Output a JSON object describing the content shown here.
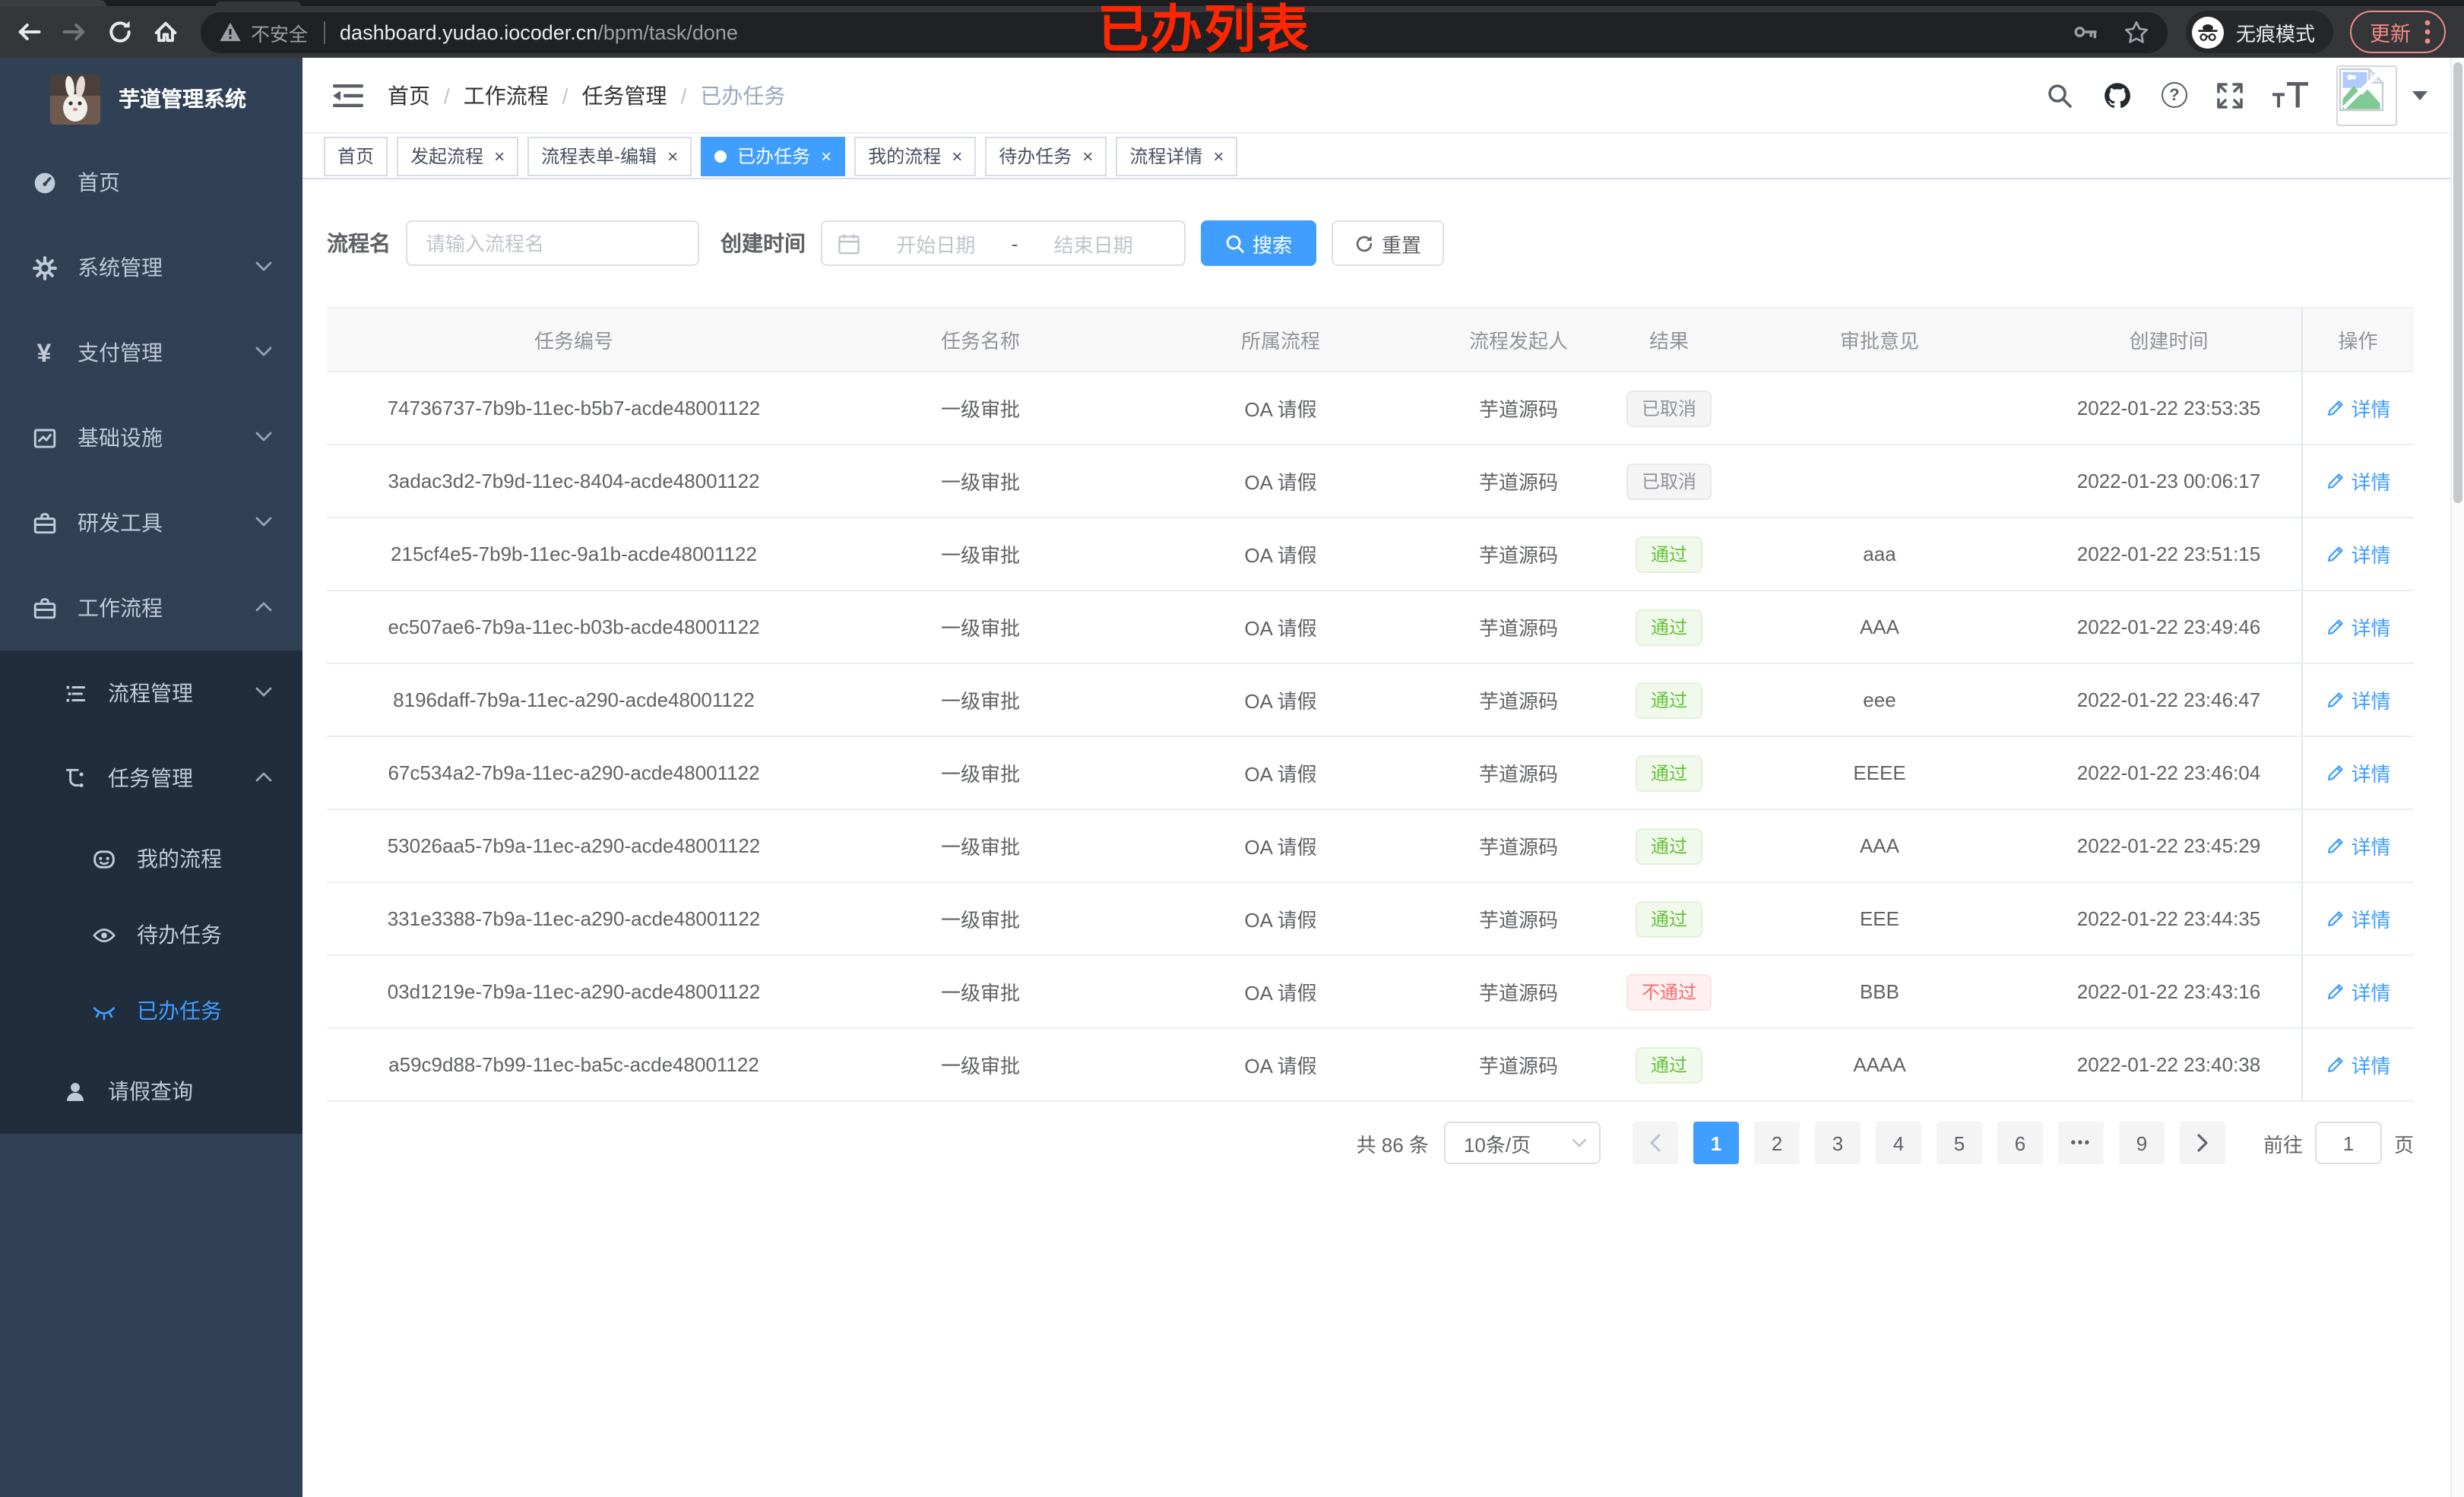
{
  "annotation": {
    "text": "已办列表",
    "color": "#ff2600"
  },
  "browser": {
    "insecure_label": "不安全",
    "url_host": "dashboard.yudao.iocoder.cn",
    "url_path": "/bpm/task/done",
    "incognito_label": "无痕模式",
    "update_label": "更新"
  },
  "sidebar": {
    "title": "芋道管理系统",
    "menu": [
      {
        "label": "首页"
      },
      {
        "label": "系统管理"
      },
      {
        "label": "支付管理"
      },
      {
        "label": "基础设施"
      },
      {
        "label": "研发工具"
      },
      {
        "label": "工作流程"
      },
      {
        "label": "流程管理"
      },
      {
        "label": "任务管理"
      },
      {
        "label": "我的流程"
      },
      {
        "label": "待办任务"
      },
      {
        "label": "已办任务"
      },
      {
        "label": "请假查询"
      }
    ]
  },
  "navbar": {
    "breadcrumb": [
      "首页",
      "工作流程",
      "任务管理",
      "已办任务"
    ],
    "separator": "/",
    "help_glyph": "?"
  },
  "tabs": [
    {
      "label": "首页"
    },
    {
      "label": "发起流程"
    },
    {
      "label": "流程表单-编辑"
    },
    {
      "label": "已办任务"
    },
    {
      "label": "我的流程"
    },
    {
      "label": "待办任务"
    },
    {
      "label": "流程详情"
    }
  ],
  "ui": {
    "close_glyph": "×"
  },
  "filter": {
    "name_label": "流程名",
    "name_placeholder": "请输入流程名",
    "time_label": "创建时间",
    "start_placeholder": "开始日期",
    "range_separator": "-",
    "end_placeholder": "结束日期",
    "search_label": "搜索",
    "reset_label": "重置"
  },
  "table": {
    "columns": [
      "任务编号",
      "任务名称",
      "所属流程",
      "流程发起人",
      "结果",
      "审批意见",
      "创建时间",
      "操作"
    ],
    "rows": [
      {
        "id": "74736737-7b9b-11ec-b5b7-acde48001122",
        "name": "一级审批",
        "process": "OA 请假",
        "starter": "芋道源码",
        "result": "已取消",
        "comment": "",
        "created": "2022-01-22 23:53:35",
        "action": "详情"
      },
      {
        "id": "3adac3d2-7b9d-11ec-8404-acde48001122",
        "name": "一级审批",
        "process": "OA 请假",
        "starter": "芋道源码",
        "result": "已取消",
        "comment": "",
        "created": "2022-01-23 00:06:17",
        "action": "详情"
      },
      {
        "id": "215cf4e5-7b9b-11ec-9a1b-acde48001122",
        "name": "一级审批",
        "process": "OA 请假",
        "starter": "芋道源码",
        "result": "通过",
        "comment": "aaa",
        "created": "2022-01-22 23:51:15",
        "action": "详情"
      },
      {
        "id": "ec507ae6-7b9a-11ec-b03b-acde48001122",
        "name": "一级审批",
        "process": "OA 请假",
        "starter": "芋道源码",
        "result": "通过",
        "comment": "AAA",
        "created": "2022-01-22 23:49:46",
        "action": "详情"
      },
      {
        "id": "8196daff-7b9a-11ec-a290-acde48001122",
        "name": "一级审批",
        "process": "OA 请假",
        "starter": "芋道源码",
        "result": "通过",
        "comment": "eee",
        "created": "2022-01-22 23:46:47",
        "action": "详情"
      },
      {
        "id": "67c534a2-7b9a-11ec-a290-acde48001122",
        "name": "一级审批",
        "process": "OA 请假",
        "starter": "芋道源码",
        "result": "通过",
        "comment": "EEEE",
        "created": "2022-01-22 23:46:04",
        "action": "详情"
      },
      {
        "id": "53026aa5-7b9a-11ec-a290-acde48001122",
        "name": "一级审批",
        "process": "OA 请假",
        "starter": "芋道源码",
        "result": "通过",
        "comment": "AAA",
        "created": "2022-01-22 23:45:29",
        "action": "详情"
      },
      {
        "id": "331e3388-7b9a-11ec-a290-acde48001122",
        "name": "一级审批",
        "process": "OA 请假",
        "starter": "芋道源码",
        "result": "通过",
        "comment": "EEE",
        "created": "2022-01-22 23:44:35",
        "action": "详情"
      },
      {
        "id": "03d1219e-7b9a-11ec-a290-acde48001122",
        "name": "一级审批",
        "process": "OA 请假",
        "starter": "芋道源码",
        "result": "不通过",
        "comment": "BBB",
        "created": "2022-01-22 23:43:16",
        "action": "详情"
      },
      {
        "id": "a59c9d88-7b99-11ec-ba5c-acde48001122",
        "name": "一级审批",
        "process": "OA 请假",
        "starter": "芋道源码",
        "result": "通过",
        "comment": "AAAA",
        "created": "2022-01-22 23:40:38",
        "action": "详情"
      }
    ]
  },
  "pagination": {
    "total": "共 86 条",
    "page_size": "10条/页",
    "pages": [
      "1",
      "2",
      "3",
      "4",
      "5",
      "6",
      "•••",
      "9"
    ],
    "goto_label": "前往",
    "goto_value": "1",
    "page_unit": "页"
  },
  "colors": {
    "accent": "#409EFF",
    "success": "#67c23a",
    "danger": "#f56c6c",
    "info": "#909399",
    "sidebar": "#304156",
    "submenu": "#1f2d3d"
  }
}
